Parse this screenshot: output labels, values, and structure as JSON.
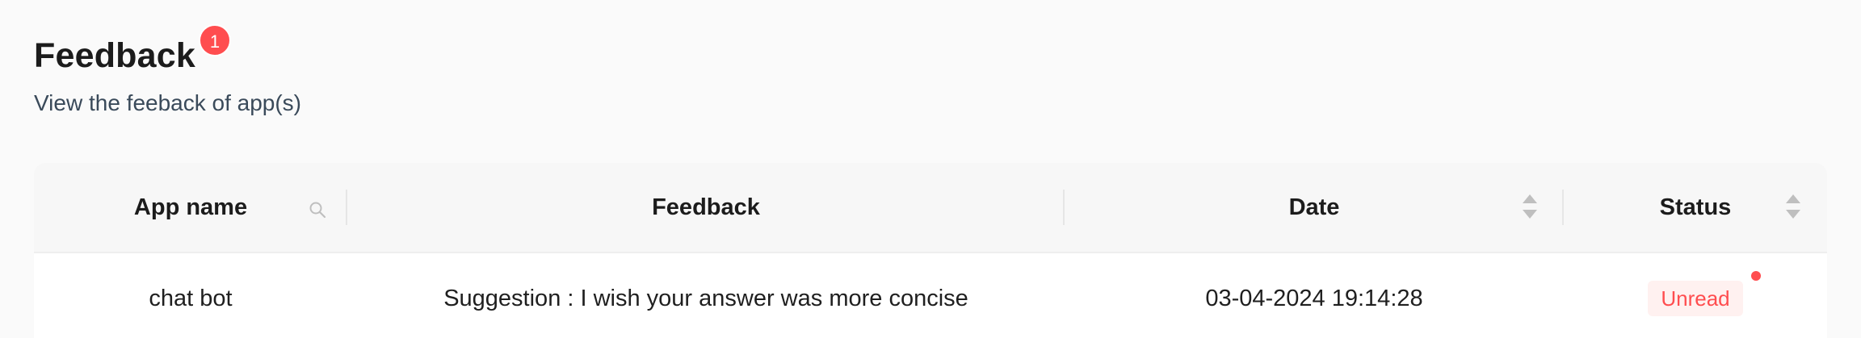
{
  "header": {
    "title": "Feedback",
    "badge_count": "1",
    "subtitle": "View the feeback of app(s)"
  },
  "table": {
    "columns": {
      "app_name": "App name",
      "feedback": "Feedback",
      "date": "Date",
      "status": "Status"
    },
    "rows": [
      {
        "app_name": "chat bot",
        "feedback": "Suggestion : I wish your answer was more concise",
        "date": "03-04-2024 19:14:28",
        "status": "Unread"
      }
    ]
  },
  "colors": {
    "accent_red": "#ff4d4f",
    "status_tag_bg": "#fff1f0",
    "header_bg": "#f7f7f7"
  },
  "icons": {
    "app_name_filter": "search-icon",
    "date_sort": "sort-icon",
    "status_sort": "sort-icon"
  }
}
